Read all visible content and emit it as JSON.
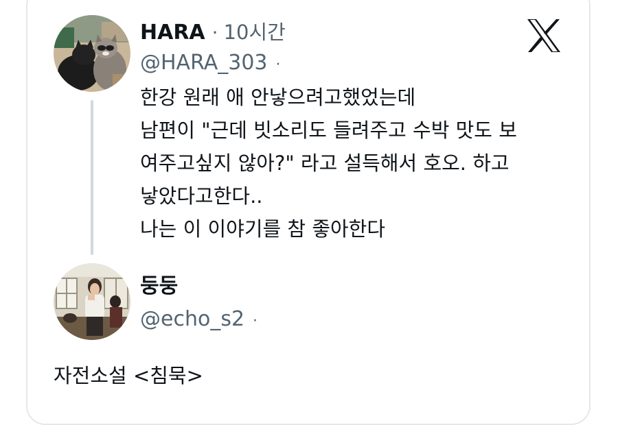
{
  "tweet1": {
    "display_name": "HARA",
    "separator": "·",
    "time": "10시간",
    "handle": "@HARA_303",
    "handle_separator": "·",
    "lines": [
      "한강 원래 애 안낳으려고했었는데",
      "남편이 \"근데 빗소리도 들려주고 수박 맛도 보",
      "여주고싶지 않아?\" 라고 설득해서 호오. 하고",
      "낳았다고한다..",
      "나는 이 이야기를 참 좋아한다"
    ]
  },
  "tweet2": {
    "display_name": "둥둥",
    "handle": "@echo_s2",
    "handle_separator": "·",
    "text": "자전소설 <침묵>"
  },
  "icons": {
    "platform_logo": "x-logo-icon",
    "avatar1": "raccoon-cat-photo-avatar",
    "avatar2": "woman-room-photo-avatar"
  },
  "colors": {
    "text": "#0f1419",
    "secondary": "#536471",
    "thread_line": "#cfd9de",
    "border": "#e4e7ea"
  }
}
